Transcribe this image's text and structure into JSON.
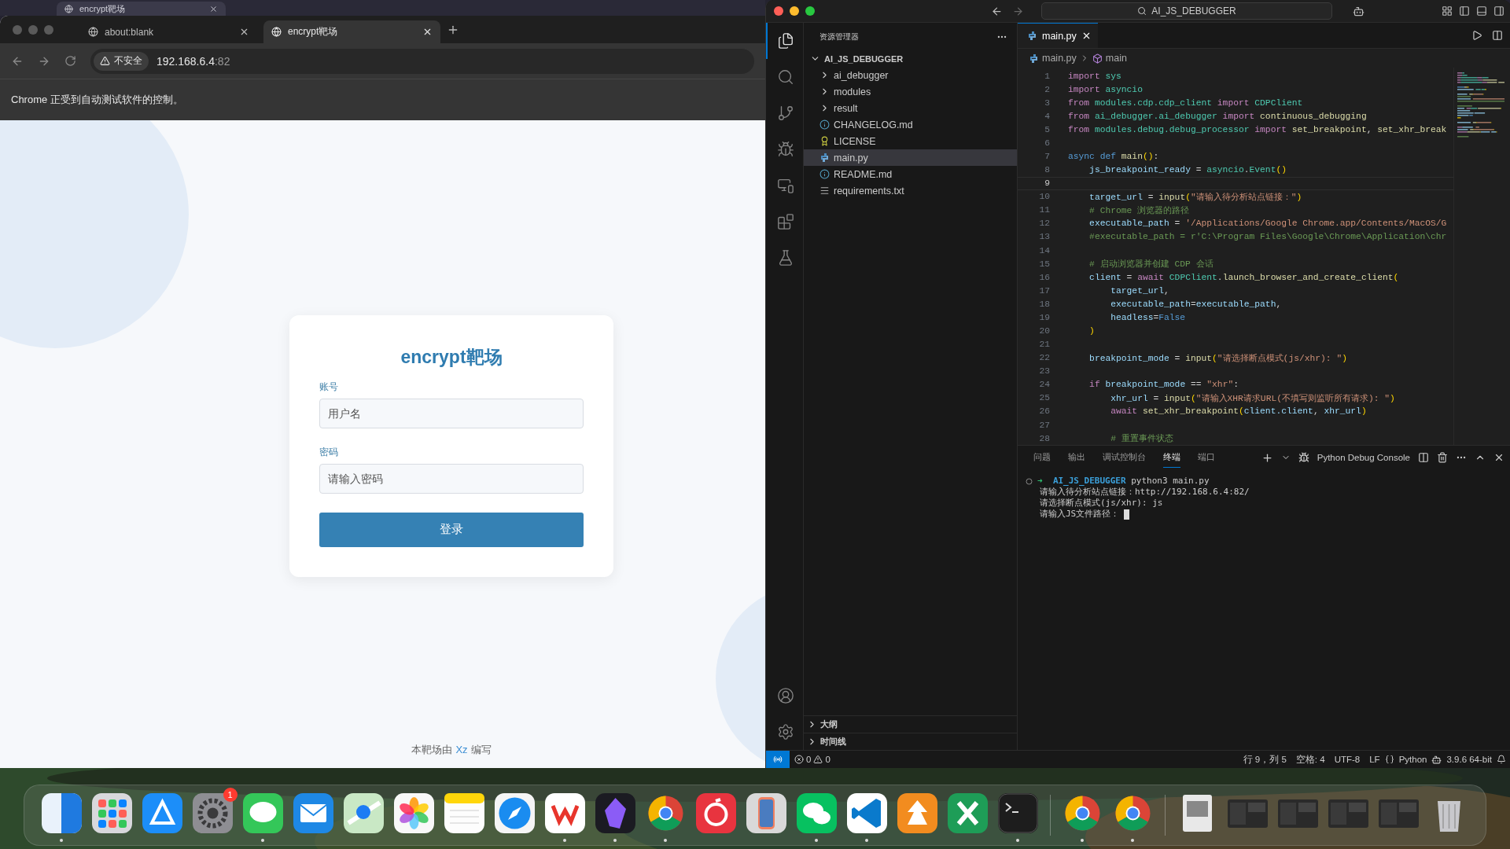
{
  "background_window": {
    "tab": {
      "label": "encrypt靶场"
    }
  },
  "browser": {
    "tabs": [
      {
        "label": "about:blank",
        "selected": false
      },
      {
        "label": "encrypt靶场",
        "selected": true
      }
    ],
    "security_badge": "不安全",
    "address": {
      "host": "192.168.6.4",
      "port": ":82"
    },
    "infobar": "Chrome 正受到自动测试软件的控制。",
    "page": {
      "title": "encrypt靶场",
      "fields": [
        {
          "label": "账号",
          "placeholder": "用户名"
        },
        {
          "label": "密码",
          "placeholder": "请输入密码"
        }
      ],
      "button": "登录",
      "footer": {
        "before": "本靶场由",
        "author": "Xz",
        "after": "编写"
      }
    }
  },
  "vscode": {
    "search": "AI_JS_DEBUGGER",
    "activity_bar": [
      {
        "selected": true
      },
      {
        "selected": false
      },
      {
        "selected": false
      },
      {
        "selected": false
      },
      {
        "selected": false
      },
      {
        "selected": false
      },
      {
        "selected": false
      }
    ],
    "explorer": {
      "title": "资源管理器",
      "tree": [
        {
          "label": "AI_JS_DEBUGGER",
          "kind": "root",
          "expanded": true,
          "selected": false,
          "children": [
            {
              "label": "ai_debugger",
              "kind": "folder",
              "expanded": false,
              "selected": false
            },
            {
              "label": "modules",
              "kind": "folder",
              "expanded": false,
              "selected": false
            },
            {
              "label": "result",
              "kind": "folder",
              "expanded": false,
              "selected": false
            },
            {
              "label": "CHANGELOG.md",
              "kind": "markdown",
              "selected": false
            },
            {
              "label": "LICENSE",
              "kind": "license",
              "selected": false
            },
            {
              "label": "main.py",
              "kind": "python",
              "selected": true
            },
            {
              "label": "README.md",
              "kind": "markdown",
              "selected": false
            },
            {
              "label": "requirements.txt",
              "kind": "text",
              "selected": false
            }
          ]
        }
      ]
    },
    "sections": [
      {
        "label": "大纲",
        "expanded": false
      },
      {
        "label": "时间线",
        "expanded": false
      }
    ],
    "editor_tabs": [
      {
        "label": "main.py",
        "selected": true
      }
    ],
    "breadcrumb": [
      "main.py",
      "main"
    ],
    "lines": [
      {
        "number": "1",
        "current": false,
        "tokens": [
          {
            "kind": "control",
            "text": "import "
          },
          {
            "kind": "module",
            "text": "sys"
          }
        ]
      },
      {
        "number": "2",
        "current": false,
        "tokens": [
          {
            "kind": "control",
            "text": "import "
          },
          {
            "kind": "module",
            "text": "asyncio"
          }
        ]
      },
      {
        "number": "3",
        "current": false,
        "tokens": [
          {
            "kind": "control",
            "text": "from "
          },
          {
            "kind": "module",
            "text": "modules.cdp.cdp_client "
          },
          {
            "kind": "control",
            "text": "import "
          },
          {
            "kind": "module",
            "text": "CDPClient"
          }
        ]
      },
      {
        "number": "4",
        "current": false,
        "tokens": [
          {
            "kind": "control",
            "text": "from "
          },
          {
            "kind": "module",
            "text": "ai_debugger.ai_debugger "
          },
          {
            "kind": "control",
            "text": "import "
          },
          {
            "kind": "function",
            "text": "continuous_debugging"
          }
        ]
      },
      {
        "number": "5",
        "current": false,
        "tokens": [
          {
            "kind": "control",
            "text": "from "
          },
          {
            "kind": "module",
            "text": "modules.debug.debug_processor "
          },
          {
            "kind": "control",
            "text": "import "
          },
          {
            "kind": "function",
            "text": "set_breakpoint"
          },
          {
            "kind": "plain",
            "text": ", "
          },
          {
            "kind": "function",
            "text": "set_xhr_break"
          }
        ]
      },
      {
        "number": "6",
        "current": false
      },
      {
        "number": "7",
        "current": false,
        "tokens": [
          {
            "kind": "keyword",
            "text": "async def "
          },
          {
            "kind": "function",
            "text": "main"
          },
          {
            "kind": "bracket",
            "text": "()"
          },
          {
            "kind": "plain",
            "text": ":"
          }
        ]
      },
      {
        "number": "8",
        "current": false,
        "tokens": [
          {
            "kind": "variable",
            "text": "    js_breakpoint_ready"
          },
          {
            "kind": "plain",
            "text": " = "
          },
          {
            "kind": "module",
            "text": "asyncio"
          },
          {
            "kind": "plain",
            "text": "."
          },
          {
            "kind": "module",
            "text": "Event"
          },
          {
            "kind": "bracket",
            "text": "()"
          }
        ]
      },
      {
        "number": "9",
        "current": true
      },
      {
        "number": "10",
        "current": false,
        "tokens": [
          {
            "kind": "variable",
            "text": "    target_url"
          },
          {
            "kind": "plain",
            "text": " = "
          },
          {
            "kind": "function",
            "text": "input"
          },
          {
            "kind": "bracket",
            "text": "("
          },
          {
            "kind": "string",
            "text": "\"请输入待分析站点链接：\""
          },
          {
            "kind": "bracket",
            "text": ")"
          }
        ]
      },
      {
        "number": "11",
        "current": false,
        "tokens": [
          {
            "kind": "comment",
            "text": "    # Chrome 浏览器的路径"
          }
        ]
      },
      {
        "number": "12",
        "current": false,
        "tokens": [
          {
            "kind": "variable",
            "text": "    executable_path"
          },
          {
            "kind": "plain",
            "text": " = "
          },
          {
            "kind": "string",
            "text": "'/Applications/Google Chrome.app/Contents/MacOS/G"
          }
        ]
      },
      {
        "number": "13",
        "current": false,
        "tokens": [
          {
            "kind": "comment",
            "text": "    #executable_path = r'C:\\Program Files\\Google\\Chrome\\Application\\chr"
          }
        ]
      },
      {
        "number": "14",
        "current": false
      },
      {
        "number": "15",
        "current": false,
        "tokens": [
          {
            "kind": "comment",
            "text": "    # 启动浏览器并创建 CDP 会话"
          }
        ]
      },
      {
        "number": "16",
        "current": false,
        "tokens": [
          {
            "kind": "variable",
            "text": "    client"
          },
          {
            "kind": "plain",
            "text": " = "
          },
          {
            "kind": "control",
            "text": "await "
          },
          {
            "kind": "module",
            "text": "CDPClient"
          },
          {
            "kind": "plain",
            "text": "."
          },
          {
            "kind": "function",
            "text": "launch_browser_and_create_client"
          },
          {
            "kind": "bracket",
            "text": "("
          }
        ]
      },
      {
        "number": "17",
        "current": false,
        "tokens": [
          {
            "kind": "variable",
            "text": "        target_url"
          },
          {
            "kind": "plain",
            "text": ","
          }
        ]
      },
      {
        "number": "18",
        "current": false,
        "tokens": [
          {
            "kind": "variable",
            "text": "        executable_path"
          },
          {
            "kind": "plain",
            "text": "="
          },
          {
            "kind": "variable",
            "text": "executable_path"
          },
          {
            "kind": "plain",
            "text": ","
          }
        ]
      },
      {
        "number": "19",
        "current": false,
        "tokens": [
          {
            "kind": "variable",
            "text": "        headless"
          },
          {
            "kind": "plain",
            "text": "="
          },
          {
            "kind": "keyword",
            "text": "False"
          }
        ]
      },
      {
        "number": "20",
        "current": false,
        "tokens": [
          {
            "kind": "bracket",
            "text": "    )"
          }
        ]
      },
      {
        "number": "21",
        "current": false
      },
      {
        "number": "22",
        "current": false,
        "tokens": [
          {
            "kind": "variable",
            "text": "    breakpoint_mode"
          },
          {
            "kind": "plain",
            "text": " = "
          },
          {
            "kind": "function",
            "text": "input"
          },
          {
            "kind": "bracket",
            "text": "("
          },
          {
            "kind": "string",
            "text": "\"请选择断点模式(js/xhr): \""
          },
          {
            "kind": "bracket",
            "text": ")"
          }
        ]
      },
      {
        "number": "23",
        "current": false
      },
      {
        "number": "24",
        "current": false,
        "tokens": [
          {
            "kind": "control",
            "text": "    if "
          },
          {
            "kind": "variable",
            "text": "breakpoint_mode"
          },
          {
            "kind": "plain",
            "text": " == "
          },
          {
            "kind": "string",
            "text": "\"xhr\""
          },
          {
            "kind": "plain",
            "text": ":"
          }
        ]
      },
      {
        "number": "25",
        "current": false,
        "tokens": [
          {
            "kind": "variable",
            "text": "        xhr_url"
          },
          {
            "kind": "plain",
            "text": " = "
          },
          {
            "kind": "function",
            "text": "input"
          },
          {
            "kind": "bracket",
            "text": "("
          },
          {
            "kind": "string",
            "text": "\"请输入XHR请求URL(不填写则监听所有请求): \""
          },
          {
            "kind": "bracket",
            "text": ")"
          }
        ]
      },
      {
        "number": "26",
        "current": false,
        "tokens": [
          {
            "kind": "control",
            "text": "        await "
          },
          {
            "kind": "function",
            "text": "set_xhr_breakpoint"
          },
          {
            "kind": "bracket",
            "text": "("
          },
          {
            "kind": "variable",
            "text": "client.client"
          },
          {
            "kind": "plain",
            "text": ", "
          },
          {
            "kind": "variable",
            "text": "xhr_url"
          },
          {
            "kind": "bracket",
            "text": ")"
          }
        ]
      },
      {
        "number": "27",
        "current": false
      },
      {
        "number": "28",
        "current": false,
        "tokens": [
          {
            "kind": "comment",
            "text": "        # 重置事件状态"
          }
        ]
      }
    ],
    "panel": {
      "tabs": [
        {
          "label": "问题",
          "selected": false
        },
        {
          "label": "输出",
          "selected": false
        },
        {
          "label": "调试控制台",
          "selected": false
        },
        {
          "label": "终端",
          "selected": true
        },
        {
          "label": "端口",
          "selected": false
        }
      ],
      "terminal_name": "Python Debug Console",
      "prompt": {
        "symbol": "➜",
        "directory": "AI_JS_DEBUGGER",
        "command": "python3 main.py"
      },
      "output": [
        "请输入待分析站点链接：http://192.168.6.4:82/",
        "请选择断点模式(js/xhr): js",
        "请输入JS文件路径："
      ]
    },
    "status_bar": {
      "errors": "0",
      "warnings": "0",
      "position": "行 9，列 5",
      "indent": "空格: 4",
      "encoding": "UTF-8",
      "eol": "LF",
      "language": "Python",
      "interpreter": "3.9.6 64-bit"
    }
  },
  "dock": {
    "items": [
      {
        "running": true
      },
      {
        "running": false
      },
      {
        "running": false
      },
      {
        "running": false,
        "badge": "1"
      },
      {
        "running": true
      },
      {
        "running": false
      },
      {
        "running": false
      },
      {
        "running": false
      },
      {
        "running": false
      },
      {
        "running": false
      },
      {
        "running": true
      },
      {
        "running": true
      },
      {
        "running": true
      },
      {
        "running": false
      },
      {
        "running": false
      },
      {
        "running": true
      },
      {
        "running": true
      },
      {
        "running": false
      },
      {
        "running": false
      },
      {
        "running": true
      },
      {
        "running": true
      },
      {
        "running": true
      },
      {
        "running": false
      },
      {
        "running": false
      },
      {
        "running": false
      },
      {
        "running": false
      },
      {
        "running": false
      },
      {
        "running": false
      }
    ]
  }
}
